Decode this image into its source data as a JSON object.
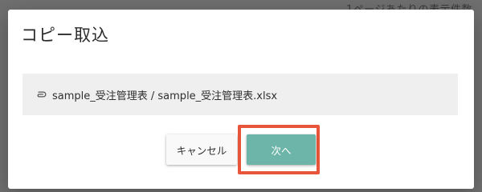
{
  "background": {
    "overlay_text": "1ページあたりの表示件数"
  },
  "dialog": {
    "title": "コピー取込",
    "file": {
      "icon": "paperclip-icon",
      "name": "sample_受注管理表 / sample_受注管理表.xlsx"
    },
    "buttons": {
      "cancel_label": "キャンセル",
      "next_label": "次へ"
    }
  },
  "colors": {
    "overlay": "#6f6f6f",
    "dialog_bg": "#ffffff",
    "file_box_bg": "#efefef",
    "next_button": "#6cb5a8",
    "highlight_border": "#e8553a"
  }
}
